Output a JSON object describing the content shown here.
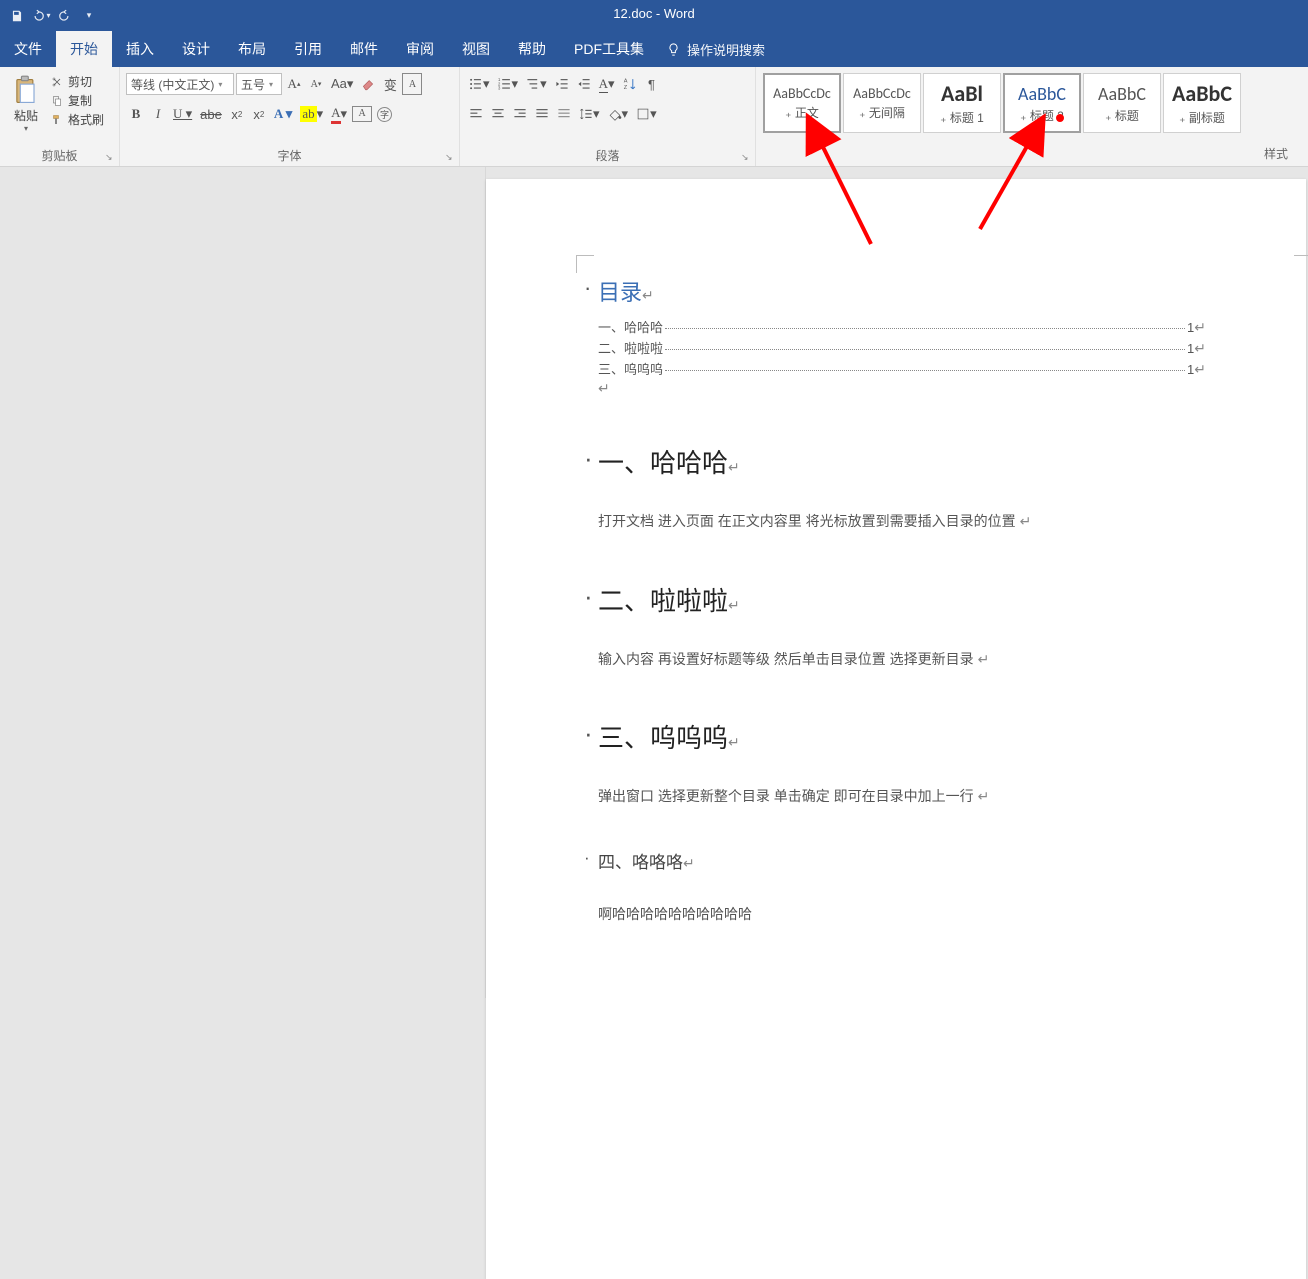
{
  "title": "12.doc  -  Word",
  "qat": {
    "save": "save-icon",
    "undo": "undo-icon",
    "redo": "redo-icon",
    "more": "▾"
  },
  "tabs": {
    "file": "文件",
    "items": [
      "开始",
      "插入",
      "设计",
      "布局",
      "引用",
      "邮件",
      "审阅",
      "视图",
      "帮助",
      "PDF工具集"
    ],
    "active": 0,
    "searchHint": "操作说明搜索"
  },
  "ribbon": {
    "clipboard": {
      "paste": "粘贴",
      "cut": "剪切",
      "copy": "复制",
      "formatPainter": "格式刷",
      "label": "剪贴板"
    },
    "font": {
      "name": "等线 (中文正文)",
      "size": "五号",
      "label": "字体"
    },
    "para": {
      "label": "段落"
    },
    "styles": {
      "label": "样式",
      "items": [
        {
          "sampleClass": "",
          "sample": "AaBbCcDc",
          "name": "正文",
          "selected": true
        },
        {
          "sampleClass": "",
          "sample": "AaBbCcDc",
          "name": "无间隔"
        },
        {
          "sampleClass": "big",
          "sample": "AaBl",
          "name": "标题 1"
        },
        {
          "sampleClass": "mid",
          "sample": "AaBbC",
          "name": "标题 2",
          "selected": true
        },
        {
          "sampleClass": "mid2",
          "sample": "AaBbC",
          "name": "标题"
        },
        {
          "sampleClass": "big",
          "sample": "AaBbC",
          "name": "副标题"
        }
      ]
    }
  },
  "doc": {
    "tocTitle": "目录",
    "toc": [
      {
        "text": "一、哈哈哈",
        "page": "1"
      },
      {
        "text": "二、啦啦啦",
        "page": "1"
      },
      {
        "text": "三、呜呜呜",
        "page": "1"
      }
    ],
    "sections": [
      {
        "heading": "一、哈哈哈",
        "body": "打开文档    进入页面    在正文内容里    将光标放置到需要插入目录的位置    "
      },
      {
        "heading": "二、啦啦啦",
        "body": "输入内容    再设置好标题等级    然后单击目录位置    选择更新目录    "
      },
      {
        "heading": "三、呜呜呜",
        "body": "弹出窗口    选择更新整个目录    单击确定    即可在目录中加上一行    "
      }
    ],
    "sub": {
      "heading": "四、咯咯咯",
      "body": "啊哈哈哈哈哈哈哈哈哈哈"
    }
  },
  "paraMark": "↵"
}
